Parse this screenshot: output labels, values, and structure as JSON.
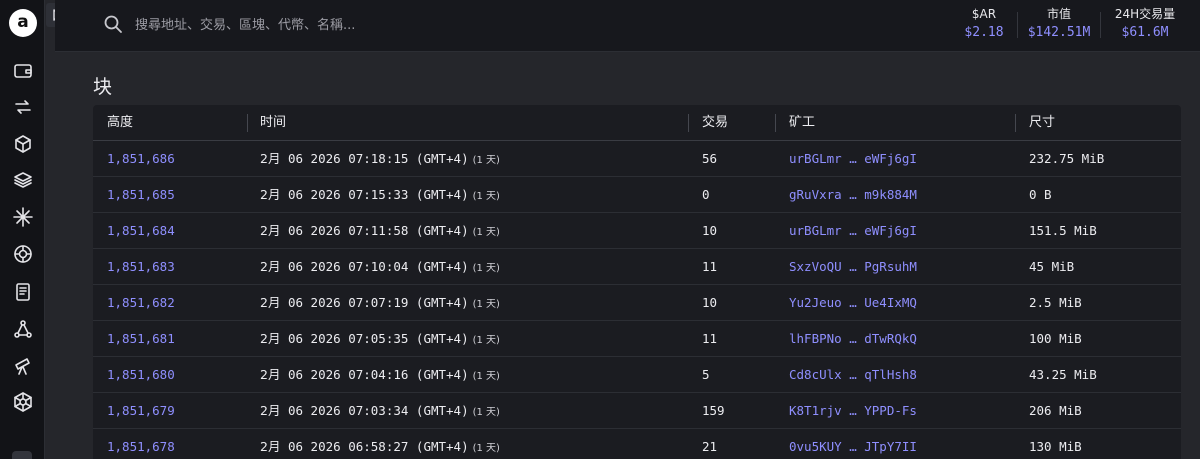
{
  "brand": {
    "logo_letter": "a"
  },
  "search": {
    "placeholder": "搜尋地址、交易、區塊、代幣、名稱..."
  },
  "stats": [
    {
      "label": "$AR",
      "value": "$2.18"
    },
    {
      "label": "市值",
      "value": "$142.51M"
    },
    {
      "label": "24H交易量",
      "value": "$61.6M"
    }
  ],
  "page": {
    "title": "块"
  },
  "table": {
    "columns": {
      "height": "高度",
      "time": "时间",
      "txs": "交易",
      "miner": "矿工",
      "size": "尺寸"
    },
    "rows": [
      {
        "height": "1,851,686",
        "month": "2月",
        "time": "06 2026 07:18:15 (GMT+4)",
        "relative": "(1 天)",
        "txs": "56",
        "miner": "urBGLmr … eWFj6gI",
        "size": "232.75 MiB"
      },
      {
        "height": "1,851,685",
        "month": "2月",
        "time": "06 2026 07:15:33 (GMT+4)",
        "relative": "(1 天)",
        "txs": "0",
        "miner": "gRuVxra … m9k884M",
        "size": "0 B"
      },
      {
        "height": "1,851,684",
        "month": "2月",
        "time": "06 2026 07:11:58 (GMT+4)",
        "relative": "(1 天)",
        "txs": "10",
        "miner": "urBGLmr … eWFj6gI",
        "size": "151.5 MiB"
      },
      {
        "height": "1,851,683",
        "month": "2月",
        "time": "06 2026 07:10:04 (GMT+4)",
        "relative": "(1 天)",
        "txs": "11",
        "miner": "SxzVoQU … PgRsuhM",
        "size": "45 MiB"
      },
      {
        "height": "1,851,682",
        "month": "2月",
        "time": "06 2026 07:07:19 (GMT+4)",
        "relative": "(1 天)",
        "txs": "10",
        "miner": "Yu2Jeuo … Ue4IxMQ",
        "size": "2.5 MiB"
      },
      {
        "height": "1,851,681",
        "month": "2月",
        "time": "06 2026 07:05:35 (GMT+4)",
        "relative": "(1 天)",
        "txs": "11",
        "miner": "lhFBPNo … dTwRQkQ",
        "size": "100 MiB"
      },
      {
        "height": "1,851,680",
        "month": "2月",
        "time": "06 2026 07:04:16 (GMT+4)",
        "relative": "(1 天)",
        "txs": "5",
        "miner": "Cd8cUlx … qTlHsh8",
        "size": "43.25 MiB"
      },
      {
        "height": "1,851,679",
        "month": "2月",
        "time": "06 2026 07:03:34 (GMT+4)",
        "relative": "(1 天)",
        "txs": "159",
        "miner": "K8T1rjv … YPPD-Fs",
        "size": "206 MiB"
      },
      {
        "height": "1,851,678",
        "month": "2月",
        "time": "06 2026 06:58:27 (GMT+4)",
        "relative": "(1 天)",
        "txs": "21",
        "miner": "0vu5KUY … JTpY7II",
        "size": "130 MiB"
      }
    ]
  },
  "nav_icons": [
    "wallet-icon",
    "transfer-icon",
    "cube-icon",
    "layers-icon",
    "sparkle-icon",
    "target-icon",
    "document-icon",
    "network-icon",
    "telescope-icon",
    "hub-icon"
  ],
  "colors": {
    "accent": "#8f8fff",
    "background": "#25262b",
    "panel": "#1b1c21",
    "rail": "#121317"
  }
}
